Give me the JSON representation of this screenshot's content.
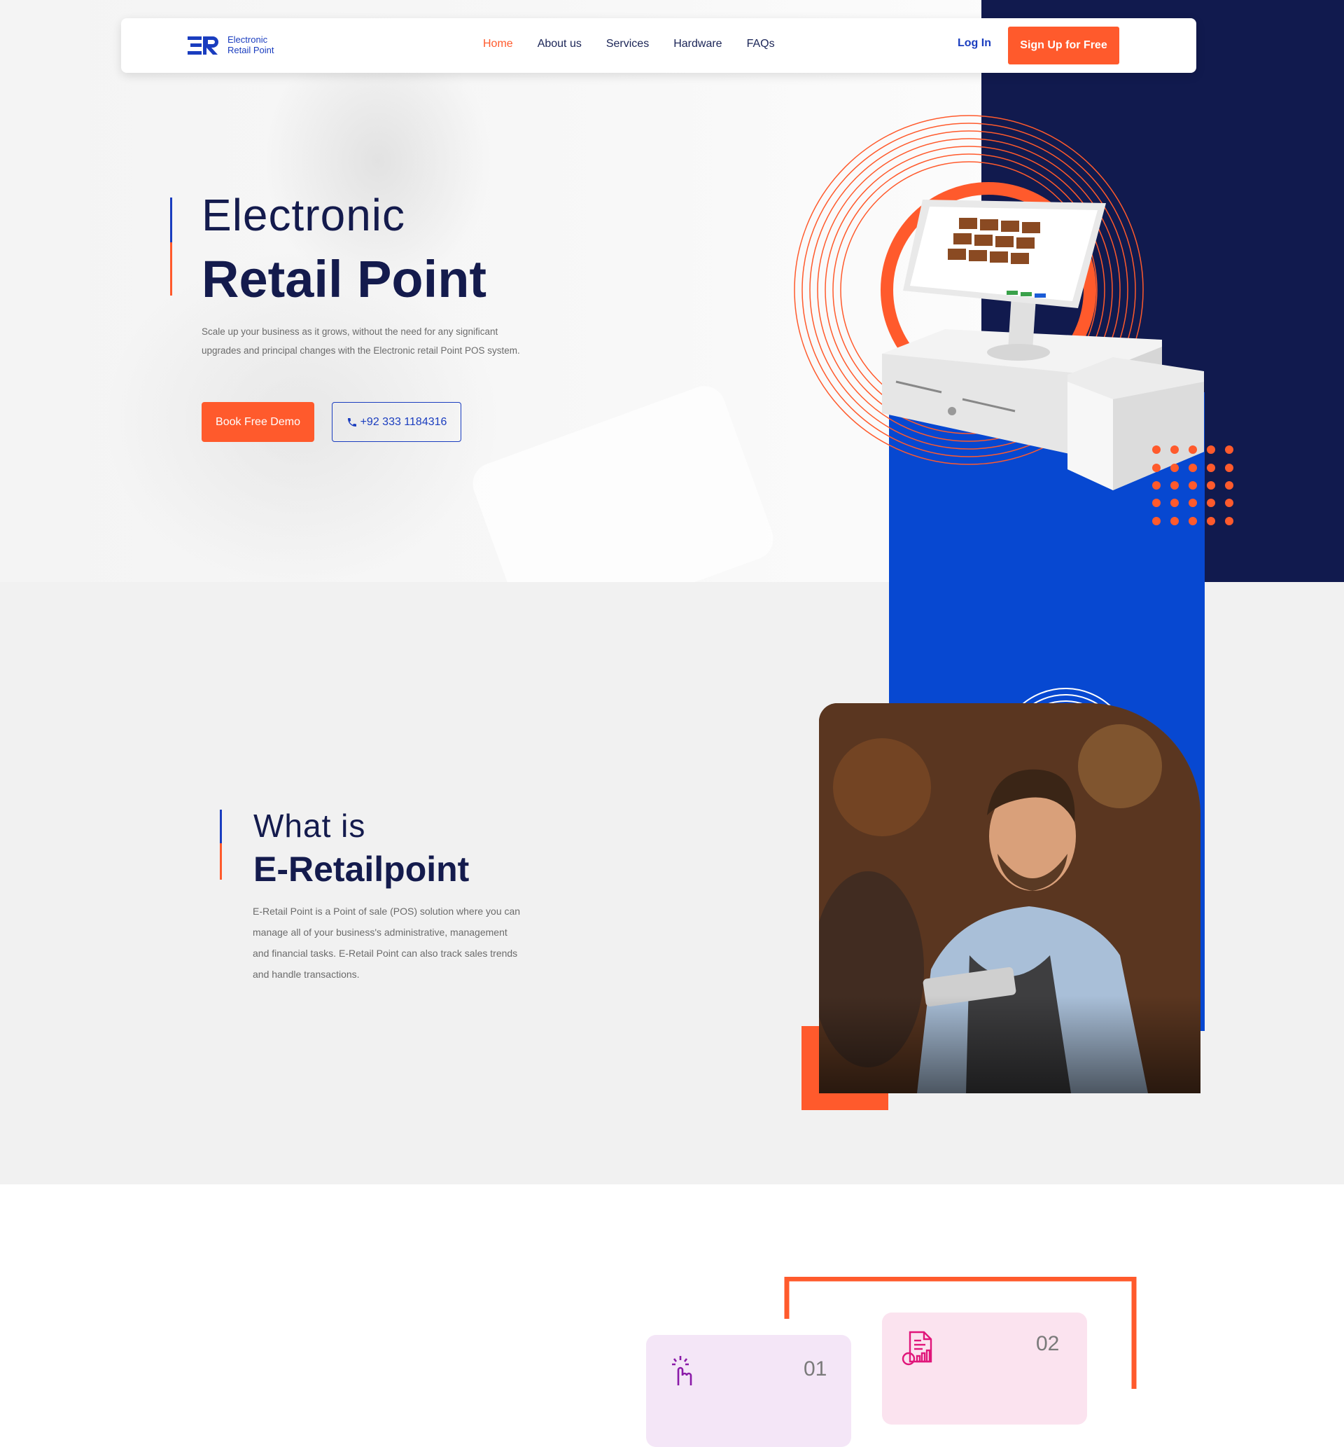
{
  "nav": {
    "logo_line1": "Electronic",
    "logo_line2": "Retail Point",
    "links": [
      "Home",
      "About us",
      "Services",
      "Hardware",
      "FAQs"
    ],
    "active_link": "Home",
    "login_label": "Log In",
    "signup_label": "Sign Up for Free"
  },
  "hero": {
    "title_line1": "Electronic",
    "title_line2": "Retail Point",
    "description": "Scale up your business as it grows, without the need for any significant upgrades and principal changes with the Electronic retail Point POS system.",
    "demo_button": "Book Free Demo",
    "phone_button": "+92 333 1184316"
  },
  "about": {
    "title_line1": "What is",
    "title_line2": "E-Retailpoint",
    "description": "E-Retail Point is a Point of sale (POS) solution where you can manage all of your business's administrative, management and financial tasks. E-Retail Point can also track sales trends and handle transactions."
  },
  "features": [
    {
      "number": "01",
      "icon": "touch-hand-icon"
    },
    {
      "number": "02",
      "icon": "report-chart-icon"
    }
  ],
  "colors": {
    "accent": "#ff5a2c",
    "navy": "#111a4e",
    "blue": "#0748d1",
    "brand": "#1a3dbf"
  }
}
